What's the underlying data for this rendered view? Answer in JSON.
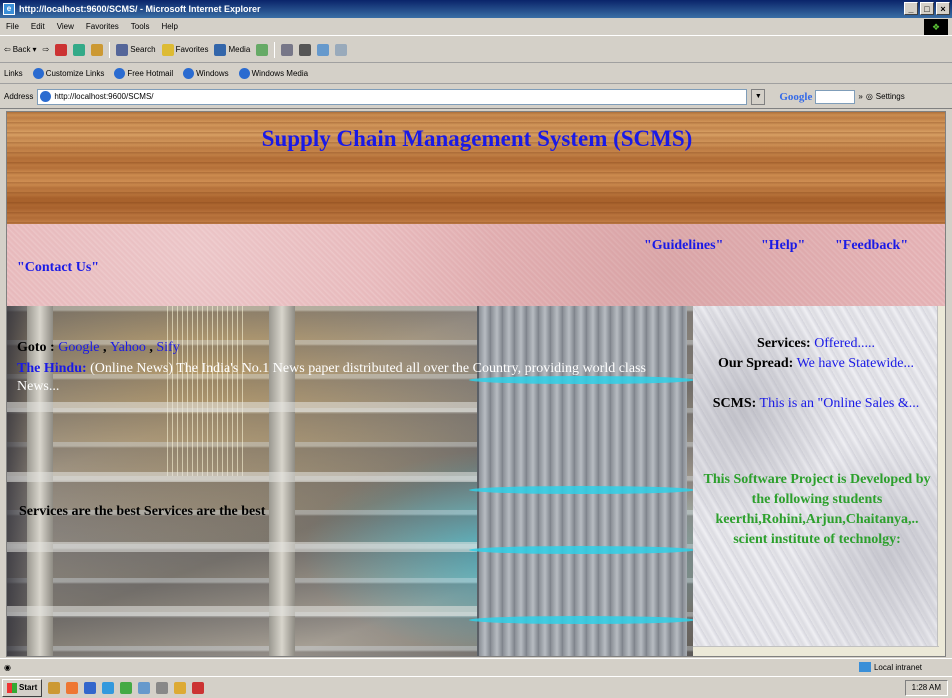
{
  "window": {
    "title": "http://localhost:9600/SCMS/ - Microsoft Internet Explorer",
    "controls": [
      "_",
      "□",
      "×"
    ]
  },
  "menubar": [
    "File",
    "Edit",
    "View",
    "Favorites",
    "Tools",
    "Help"
  ],
  "toolbar": {
    "back": "Back",
    "search": "Search",
    "favorites": "Favorites",
    "media": "Media"
  },
  "links": {
    "label": "Links",
    "items": [
      "Customize Links",
      "Free Hotmail",
      "Windows",
      "Windows Media"
    ]
  },
  "address": {
    "label": "Address",
    "url": "http://localhost:9600/SCMS/",
    "google": "Google",
    "settings": "Settings"
  },
  "page": {
    "title": "Supply Chain Management System (SCMS)",
    "nav": {
      "guidelines": "\"Guidelines\"",
      "help": "\"Help\"",
      "feedback": "\"Feedback\"",
      "contact": "\"Contact Us\""
    },
    "goto": {
      "label": "Goto :",
      "links": [
        "Google",
        "Yahoo",
        "Sify"
      ]
    },
    "hindu": {
      "label": "The Hindu:",
      "text": " (Online News) The India's No.1 News paper distributed all over the Country, providing world class News..."
    },
    "services_best": "Services are the best Services are the best",
    "sidebar": {
      "services_label": "Services:",
      "services_value": "Offered.....",
      "spread_label": "Our Spread:",
      "spread_value": "We have Statewide...",
      "scms_label": "SCMS:",
      "scms_value": "This is an \"Online Sales &...",
      "credits": "This Software Project is Developed by the following students keerthi,Rohini,Arjun,Chaitanya,.. scient institute of technolgy:"
    }
  },
  "status": {
    "zone": "Local intranet"
  },
  "taskbar": {
    "start": "Start",
    "clock": "1:28 AM"
  }
}
